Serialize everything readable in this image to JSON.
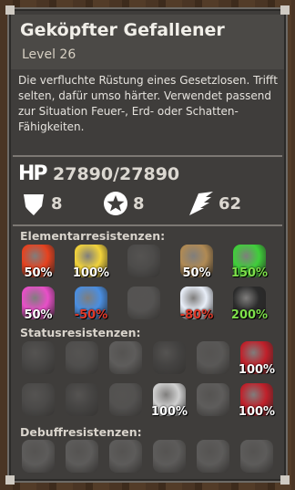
{
  "monster": {
    "name": "Geköpfter Gefallener",
    "level": "Level 26",
    "description": "Die verfluchte Rüstung eines Gesetzlosen. Trifft selten, dafür umso härter. Verwendet passend zur Situation Feuer-, Erd- oder Schatten-Fähigkeiten."
  },
  "stats": {
    "hp_label": "HP",
    "hp": "27890/27890",
    "defense": "8",
    "magic_defense": "8",
    "speed": "62"
  },
  "sections": {
    "elemental": "Elementarresistenzen:",
    "status": "Statusresistenzen:",
    "debuff": "Debuffresistenzen:"
  },
  "elemental": [
    {
      "icon": "fire-icon",
      "value": "50%",
      "color": "#e6421f",
      "state": "normal"
    },
    {
      "icon": "lightning-icon",
      "value": "100%",
      "color": "#f2d33a",
      "state": "normal"
    },
    {
      "icon": "crystal-icon",
      "value": "",
      "color": "#4a6a9a",
      "state": "dim"
    },
    {
      "icon": "earth-icon",
      "value": "50%",
      "color": "#b08a54",
      "state": "normal"
    },
    {
      "icon": "poison-icon",
      "value": "150%",
      "color": "#3fcf3a",
      "state": "pos"
    },
    {
      "icon": "light-icon",
      "value": "50%",
      "color": "#e84fc8",
      "state": "normal"
    },
    {
      "icon": "water-icon",
      "value": "-50%",
      "color": "#4a8ee0",
      "state": "neg"
    },
    {
      "icon": "wind-icon",
      "value": "",
      "color": "#5d8a5d",
      "state": "dim"
    },
    {
      "icon": "holy-icon",
      "value": "-80%",
      "color": "#e8eef8",
      "state": "neg"
    },
    {
      "icon": "dark-icon",
      "value": "200%",
      "color": "#2b2b2b",
      "state": "pos"
    }
  ],
  "status": [
    {
      "icon": "bleed-icon",
      "value": "",
      "color": "#c2432b",
      "state": "dim"
    },
    {
      "icon": "slow-icon",
      "value": "",
      "color": "#8a6a4a",
      "state": "dim"
    },
    {
      "icon": "freeze-icon",
      "value": "",
      "color": "#6aa0c8",
      "state": "dim"
    },
    {
      "icon": "poison-orb-icon",
      "value": "",
      "color": "#7a3a8a",
      "state": "dim"
    },
    {
      "icon": "seal-icon",
      "value": "",
      "color": "#8a8a8a",
      "state": "dim"
    },
    {
      "icon": "death-icon",
      "value": "100%",
      "color": "#c0202a",
      "state": "normal"
    },
    {
      "icon": "confuse-icon",
      "value": "",
      "color": "#c24a3a",
      "state": "dim"
    },
    {
      "icon": "sleep-icon",
      "value": "",
      "color": "#5a4a9a",
      "state": "dim"
    },
    {
      "icon": "weaken-icon",
      "value": "",
      "color": "#4a8a4a",
      "state": "dim"
    },
    {
      "icon": "break-icon",
      "value": "100%",
      "color": "#d0d0d0",
      "state": "normal"
    },
    {
      "icon": "blind-icon",
      "value": "",
      "color": "#b89a2a",
      "state": "dim"
    },
    {
      "icon": "doom-icon",
      "value": "100%",
      "color": "#c0202a",
      "state": "normal"
    }
  ],
  "debuff": [
    {
      "icon": "attack-down-icon"
    },
    {
      "icon": "magic-down-icon"
    },
    {
      "icon": "defense-down-icon"
    },
    {
      "icon": "magic-defense-down-icon"
    },
    {
      "icon": "accuracy-down-icon"
    },
    {
      "icon": "speed-down-icon"
    }
  ]
}
